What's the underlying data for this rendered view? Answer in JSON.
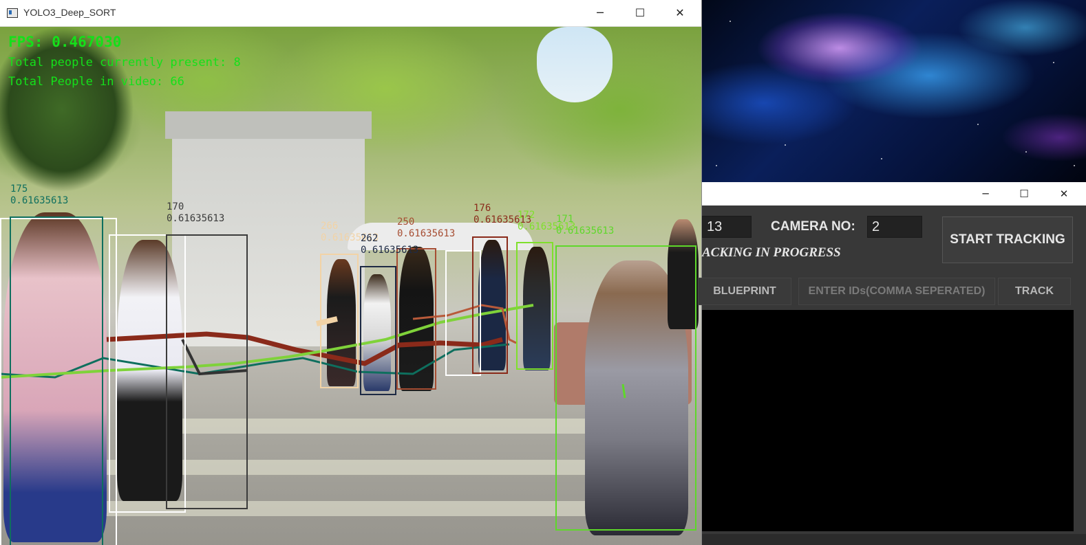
{
  "video_window": {
    "title": "YOLO3_Deep_SORT",
    "controls": {
      "minimize": "─",
      "maximize": "☐",
      "close": "✕"
    },
    "hud": {
      "fps": "FPS: 0.467030",
      "present": "Total people currently present: 8",
      "total": "Total People in video: 66"
    },
    "detections": [
      {
        "id": "175",
        "conf": "0.61635613",
        "color": "#0e6f5e"
      },
      {
        "id": "170",
        "conf": "0.61635613",
        "color": "#3b3b3b"
      },
      {
        "id": "266",
        "conf": "0.61635613",
        "color": "#f2d3a6"
      },
      {
        "id": "262",
        "conf": "0.61635613",
        "color": "#1d2a44"
      },
      {
        "id": "250",
        "conf": "0.61635613",
        "color": "#a64d32"
      },
      {
        "id": "176",
        "conf": "0.61635613",
        "color": "#8a2a1a"
      },
      {
        "id": "172",
        "conf": "0.61635613",
        "color": "#7fe02b"
      },
      {
        "id": "171",
        "conf": "0.61635613",
        "color": "#5ed82a"
      }
    ]
  },
  "control_window": {
    "controls": {
      "minimize": "─",
      "maximize": "☐",
      "close": "✕"
    },
    "cut_off_field": "13",
    "camera_label": "CAMERA NO:",
    "camera_value": "2",
    "start_button": "START TRACKING",
    "status": "ACKING IN PROGRESS",
    "blueprint_button": "BLUEPRINT",
    "ids_placeholder": "ENTER IDs(COMMA SEPERATED)",
    "track_button": "TRACK"
  }
}
